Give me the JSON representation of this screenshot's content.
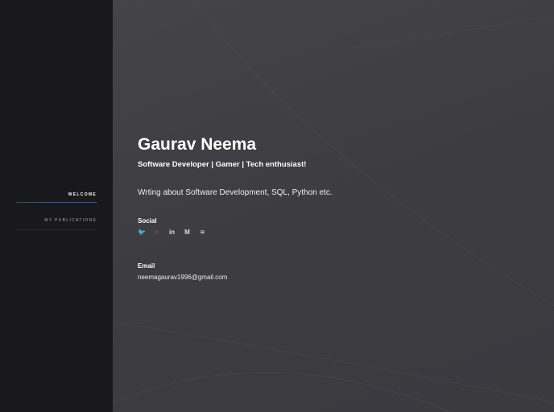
{
  "sidebar": {
    "items": [
      {
        "label": "WELCOME",
        "active": true
      },
      {
        "label": "MY PUBLICATIONS",
        "active": false
      }
    ]
  },
  "profile": {
    "name": "Gaurav Neema",
    "tagline": "Software Developer | Gamer | Tech enthusiast!",
    "bio": "Wrting about Software Development, SQL, Python etc.",
    "social_label": "Social",
    "social": [
      {
        "icon": "twitter-icon",
        "glyph": "🐦"
      },
      {
        "icon": "github-icon",
        "glyph": "◌"
      },
      {
        "icon": "linkedin-icon",
        "glyph": "in"
      },
      {
        "icon": "medium-icon",
        "glyph": "M"
      },
      {
        "icon": "rss-icon",
        "glyph": "≋"
      }
    ],
    "email_label": "Email",
    "email": "neemagaurav1996@gmail.com"
  },
  "colors": {
    "accent": "#2f5aa8"
  }
}
